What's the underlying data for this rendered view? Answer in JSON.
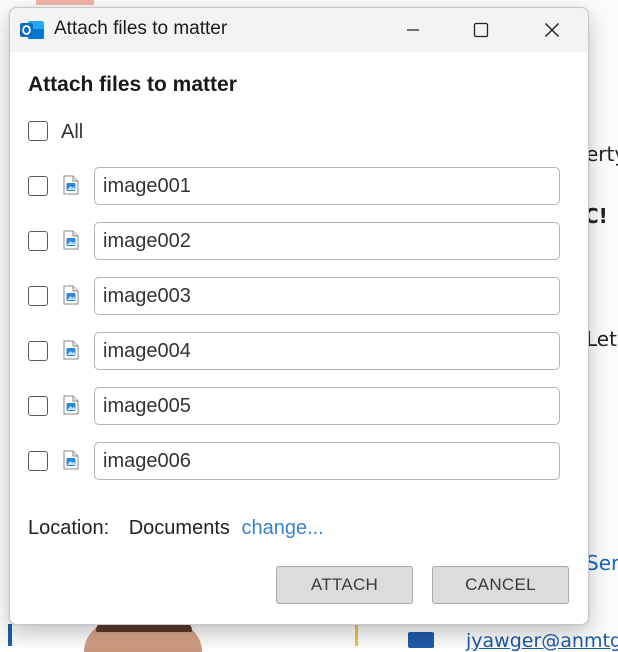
{
  "background": {
    "fragments": [
      "erty",
      "C!",
      "Let",
      "Serv"
    ],
    "email": "jyawger@anmtg"
  },
  "dialog": {
    "window_title": "Attach files to matter",
    "heading": "Attach files to matter",
    "select_all_label": "All",
    "files": [
      {
        "name": "image001",
        "checked": false
      },
      {
        "name": "image002",
        "checked": false
      },
      {
        "name": "image003",
        "checked": false
      },
      {
        "name": "image004",
        "checked": false
      },
      {
        "name": "image005",
        "checked": false
      },
      {
        "name": "image006",
        "checked": false
      }
    ],
    "location": {
      "label": "Location:",
      "value": "Documents",
      "change_link": "change..."
    },
    "buttons": {
      "attach": "ATTACH",
      "cancel": "CANCEL"
    }
  },
  "icons": {
    "app": "outlook-icon",
    "minimize": "minimize-icon",
    "maximize": "maximize-icon",
    "close": "close-icon",
    "file": "image-file-icon"
  },
  "colors": {
    "accent_link": "#3a84c9",
    "outlook_blue": "#0f6cbd",
    "button_bg": "#dcdcdc"
  }
}
